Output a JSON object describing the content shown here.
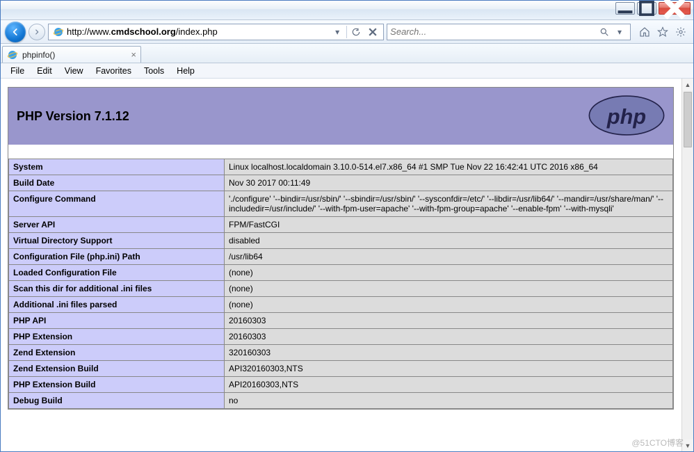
{
  "browser": {
    "url_prefix": "http://www.",
    "url_domain": "cmdschool.org",
    "url_path": "/index.php",
    "search_placeholder": "Search...",
    "tab_title": "phpinfo()",
    "menu": [
      "File",
      "Edit",
      "View",
      "Favorites",
      "Tools",
      "Help"
    ]
  },
  "phpinfo": {
    "title": "PHP Version 7.1.12",
    "rows": [
      {
        "k": "System",
        "v": "Linux localhost.localdomain 3.10.0-514.el7.x86_64 #1 SMP Tue Nov 22 16:42:41 UTC 2016 x86_64"
      },
      {
        "k": "Build Date",
        "v": "Nov 30 2017 00:11:49"
      },
      {
        "k": "Configure Command",
        "v": "'./configure' '--bindir=/usr/sbin/' '--sbindir=/usr/sbin/' '--sysconfdir=/etc/' '--libdir=/usr/lib64/' '--mandir=/usr/share/man/' '--includedir=/usr/include/' '--with-fpm-user=apache' '--with-fpm-group=apache' '--enable-fpm' '--with-mysqli'"
      },
      {
        "k": "Server API",
        "v": "FPM/FastCGI"
      },
      {
        "k": "Virtual Directory Support",
        "v": "disabled"
      },
      {
        "k": "Configuration File (php.ini) Path",
        "v": "/usr/lib64"
      },
      {
        "k": "Loaded Configuration File",
        "v": "(none)"
      },
      {
        "k": "Scan this dir for additional .ini files",
        "v": "(none)"
      },
      {
        "k": "Additional .ini files parsed",
        "v": "(none)"
      },
      {
        "k": "PHP API",
        "v": "20160303"
      },
      {
        "k": "PHP Extension",
        "v": "20160303"
      },
      {
        "k": "Zend Extension",
        "v": "320160303"
      },
      {
        "k": "Zend Extension Build",
        "v": "API320160303,NTS"
      },
      {
        "k": "PHP Extension Build",
        "v": "API20160303,NTS"
      },
      {
        "k": "Debug Build",
        "v": "no"
      }
    ]
  },
  "watermark": "@51CTO博客"
}
